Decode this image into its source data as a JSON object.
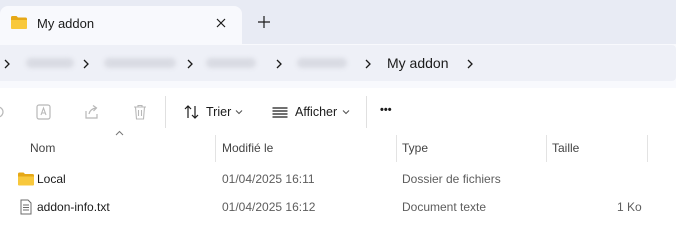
{
  "tab": {
    "title": "My addon",
    "close_icon": "close-icon",
    "new_tab_icon": "plus-icon"
  },
  "breadcrumb": {
    "current": "My addon"
  },
  "commandbar": {
    "sort_label": "Trier",
    "view_label": "Afficher",
    "more_label": "•••"
  },
  "columns": {
    "name": "Nom",
    "modified": "Modifié le",
    "type": "Type",
    "size": "Taille"
  },
  "files": [
    {
      "name": "Local",
      "modified": "01/04/2025 16:11",
      "type": "Dossier de fichiers",
      "size": "",
      "icon": "folder-icon"
    },
    {
      "name": "addon-info.txt",
      "modified": "01/04/2025 16:12",
      "type": "Document texte",
      "size": "1 Ko",
      "icon": "text-file-icon"
    }
  ],
  "colors": {
    "folder": "#f4c542",
    "tab_strip": "#e8ebf4",
    "active_tab": "#f8f9fd"
  }
}
